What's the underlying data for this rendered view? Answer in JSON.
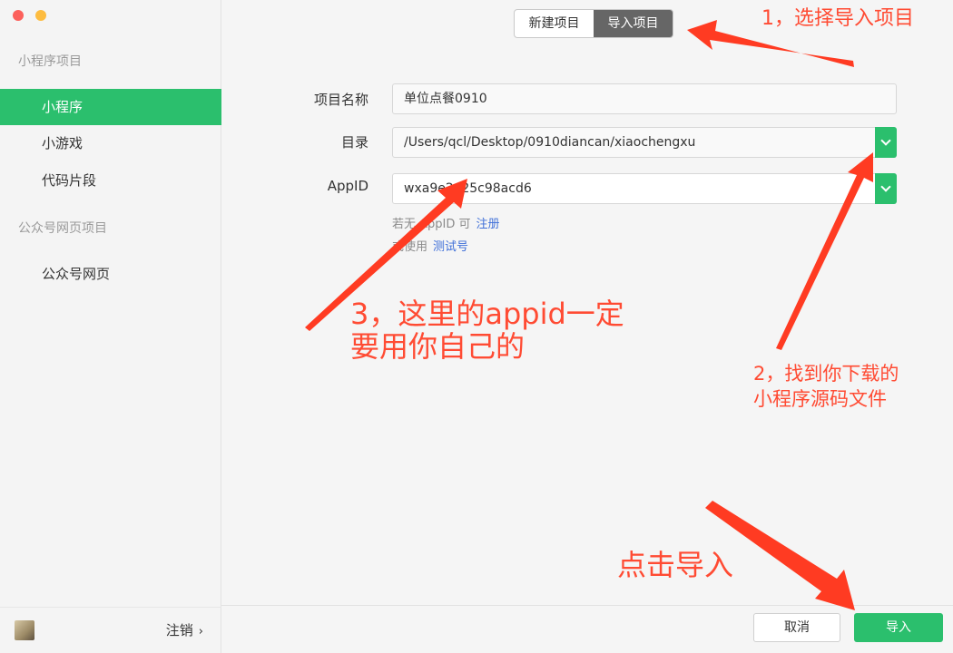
{
  "sidebar": {
    "section_miniprogram": "小程序项目",
    "items": [
      {
        "label": "小程序"
      },
      {
        "label": "小游戏"
      },
      {
        "label": "代码片段"
      }
    ],
    "section_official": "公众号网页项目",
    "official_item": "公众号网页",
    "logout_label": "注销",
    "logout_chevron": "›"
  },
  "tabs": {
    "new_project": "新建项目",
    "import_project": "导入项目"
  },
  "form": {
    "name_label": "项目名称",
    "name_value": "单位点餐0910",
    "dir_label": "目录",
    "dir_value": "/Users/qcl/Desktop/0910diancan/xiaochengxu",
    "appid_label": "AppID",
    "appid_value": "wxa9e2e25c98acd6",
    "hint1_text": "若无 AppID 可",
    "hint1_link": "注册",
    "hint2_text": "或使用",
    "hint2_link": "测试号"
  },
  "annotations": {
    "step1": "1，选择导入项目",
    "step2_line1": "2，找到你下载的",
    "step2_line2": "小程序源码文件",
    "step3_line1": "3，这里的appid一定",
    "step3_line2": "要用你自己的",
    "step4": "点击导入"
  },
  "footer": {
    "cancel_label": "取消",
    "import_label": "导入"
  },
  "colors": {
    "accent_green": "#2bbf6d",
    "annotation_red": "#ff4b33",
    "link_blue": "#3f6fd8"
  }
}
